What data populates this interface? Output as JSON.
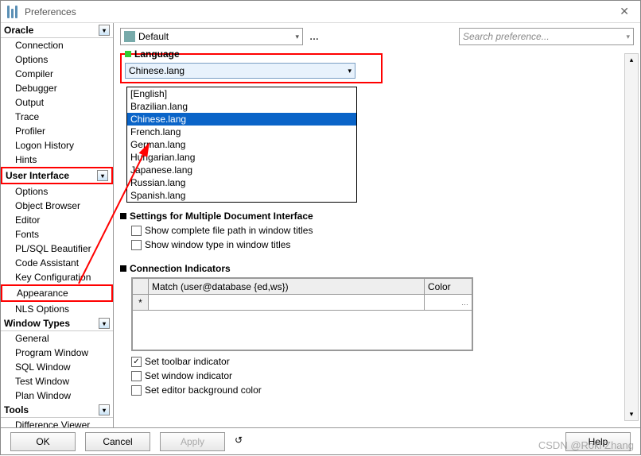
{
  "window": {
    "title": "Preferences"
  },
  "sidebar": {
    "sections": [
      {
        "label": "Oracle",
        "items": [
          "Connection",
          "Options",
          "Compiler",
          "Debugger",
          "Output",
          "Trace",
          "Profiler",
          "Logon History",
          "Hints"
        ]
      },
      {
        "label": "User Interface",
        "items": [
          "Options",
          "Object Browser",
          "Editor",
          "Fonts",
          "PL/SQL Beautifier",
          "Code Assistant",
          "Key Configuration",
          "Appearance",
          "NLS Options"
        ]
      },
      {
        "label": "Window Types",
        "items": [
          "General",
          "Program Window",
          "SQL Window",
          "Test Window",
          "Plan Window"
        ]
      },
      {
        "label": "Tools",
        "items": [
          "Difference Viewer"
        ]
      }
    ]
  },
  "toolbar": {
    "profile": "Default",
    "search_placeholder": "Search preference..."
  },
  "language": {
    "title": "Language",
    "selected": "Chinese.lang",
    "options": [
      "[English]",
      "Brazilian.lang",
      "Chinese.lang",
      "French.lang",
      "German.lang",
      "Hungarian.lang",
      "Japanese.lang",
      "Russian.lang",
      "Spanish.lang"
    ]
  },
  "mdi": {
    "title": "Settings for Multiple Document Interface",
    "opt1": "Show complete file path in window titles",
    "opt2": "Show window type in window titles"
  },
  "conn": {
    "title": "Connection Indicators",
    "col_match": "Match (user@database {ed,ws})",
    "col_color": "Color",
    "row_marker": "*",
    "opt_toolbar": "Set toolbar indicator",
    "opt_window": "Set window indicator",
    "opt_editor": "Set editor background color",
    "toolbar_checked": "✓"
  },
  "footer": {
    "ok": "OK",
    "cancel": "Cancel",
    "apply": "Apply",
    "help": "Help"
  },
  "watermark": "CSDN @Roki Zhang"
}
